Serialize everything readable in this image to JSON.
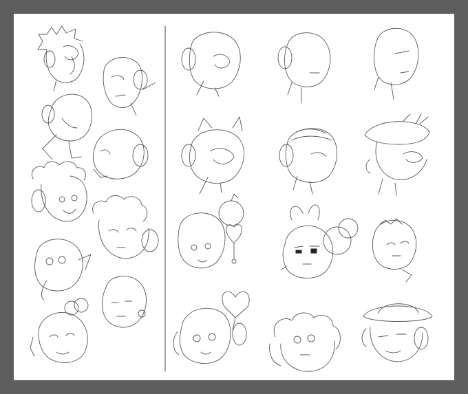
{
  "canvas": {
    "background": "#5e5e5e",
    "paper": "#ffffff",
    "line": "#555555"
  },
  "left_panel_sketches": [
    {
      "kind": "spiky-hair-headphones"
    },
    {
      "kind": "bald-profile-headphones"
    },
    {
      "kind": "round-head-headphones"
    },
    {
      "kind": "bald-profile-headphones"
    },
    {
      "kind": "curly-hair-headphones"
    },
    {
      "kind": "curly-hair-headphones"
    },
    {
      "kind": "pointy-ear-kid"
    },
    {
      "kind": "short-hair-earring"
    },
    {
      "kind": "bun-hair-girl"
    }
  ],
  "right_panel_sketches": [
    {
      "kind": "bald-headphones"
    },
    {
      "kind": "bald-headphones"
    },
    {
      "kind": "bald-profile"
    },
    {
      "kind": "horned-helmet-goggles"
    },
    {
      "kind": "striped-helmet"
    },
    {
      "kind": "antenna-cap-goggles"
    },
    {
      "kind": "balloon-hair-girl"
    },
    {
      "kind": "bunny-ears-headphones"
    },
    {
      "kind": "short-hair-boy"
    },
    {
      "kind": "heart-balloon-girl"
    },
    {
      "kind": "curly-hair-girl"
    },
    {
      "kind": "ringed-planet-hat"
    }
  ]
}
